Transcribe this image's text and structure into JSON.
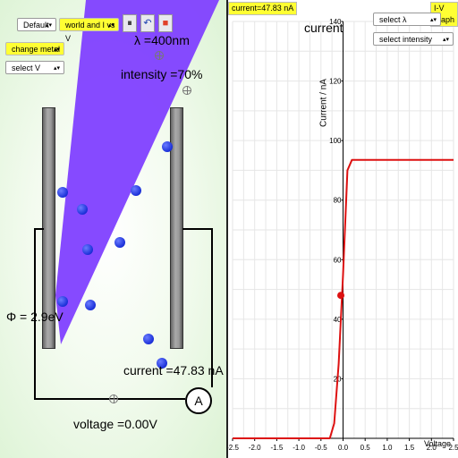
{
  "controls": {
    "scene_select": "Default",
    "view_select": "world and I vs V",
    "metal_select": "change metal",
    "voltage_select": "select V",
    "pause_icon": "⏸",
    "undo_icon": "↶",
    "stop_icon": "■"
  },
  "scene": {
    "lambda_label": "λ =400nm",
    "intensity_label": "intensity =70%",
    "phi_label": "Φ = 2.9eV",
    "current_label": "current =47.83 nA",
    "voltage_label": "voltage =0.00V",
    "ammeter_symbol": "A",
    "beam_color": "#8040ff"
  },
  "graph": {
    "current_readout": "current=47.83 nA",
    "iv_graph_button": "I-V graph",
    "lambda_select": "select λ",
    "intensity_select": "select intensity",
    "current_overlay": "current",
    "line_color": "#dd1111"
  },
  "chart_data": {
    "type": "line",
    "title": "",
    "xlabel": "Voltage",
    "ylabel": "Current / nA",
    "xlim": [
      -2.5,
      2.5
    ],
    "ylim": [
      0,
      140
    ],
    "xticks": [
      "-2.5",
      "-2.0",
      "-1.5",
      "-1.0",
      "-0.5",
      "0.0",
      "0.5",
      "1.0",
      "1.5",
      "2.0",
      "2.5"
    ],
    "yticks": [
      "20",
      "40",
      "60",
      "80",
      "100",
      "120",
      "140"
    ],
    "grid": true,
    "series": [
      {
        "x": [
          -2.5,
          -1.0,
          -0.3,
          -0.2,
          -0.1,
          0.0,
          0.1,
          0.2,
          2.5
        ],
        "y": [
          0,
          0,
          0,
          5,
          25,
          55,
          90,
          93.5,
          93.5
        ]
      }
    ],
    "marker": {
      "x": -0.05,
      "y": 48
    }
  }
}
